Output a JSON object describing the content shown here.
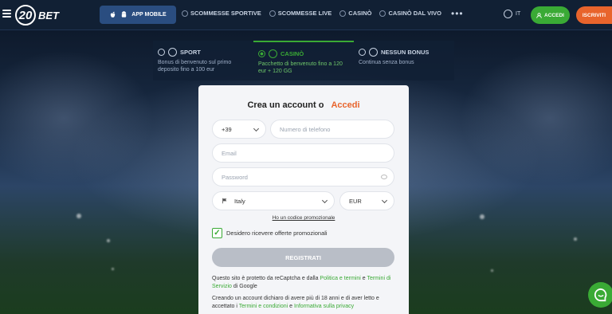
{
  "header": {
    "logo_number": "20",
    "logo_text": "BET",
    "app_button": "APP MOBILE",
    "nav": [
      "SCOMMESSE SPORTIVE",
      "SCOMMESSE LIVE",
      "CASINÒ",
      "CASINÒ DAL VIVO"
    ],
    "more": "•••",
    "language": "IT",
    "login": "ACCEDI",
    "register": "ISCRIVITI"
  },
  "bonus": {
    "tabs": [
      {
        "title": "SPORT",
        "desc": "Bonus di benvenuto sul primo deposito fino a 100 eur",
        "active": false
      },
      {
        "title": "CASINÒ",
        "desc": "Pacchetto di benvenuto fino a 120 eur + 120 GG",
        "active": true
      },
      {
        "title": "NESSUN BONUS",
        "desc": "Continua senza bonus",
        "active": false
      }
    ]
  },
  "form": {
    "title": "Crea un account o",
    "title_link": "Accedi",
    "phone_code": "+39",
    "phone_placeholder": "Numero di telefono",
    "email_placeholder": "Email",
    "password_placeholder": "Password",
    "country": "Italy",
    "currency": "EUR",
    "promo_link": "Ho un codice promozionale",
    "checkbox_label": "Desidero ricevere offerte promozionali",
    "checkbox_checked": true,
    "submit": "REGISTRATI",
    "legal1": {
      "pre": "Questo sito è protetto da reCaptcha e dalla ",
      "link1": "Politica e termini",
      "mid": " e ",
      "link2": "Termini di Servizio",
      "post": " di Google"
    },
    "legal2": {
      "pre": "Creando un account dichiaro di avere più di 18 anni e di aver letto e accettato i ",
      "link1": "Termini e condizioni",
      "mid": " e ",
      "link2": "Informativa sulla privacy"
    }
  },
  "colors": {
    "accent_green": "#3aaa35",
    "accent_orange": "#e8642c",
    "header_bg": "#112034"
  }
}
